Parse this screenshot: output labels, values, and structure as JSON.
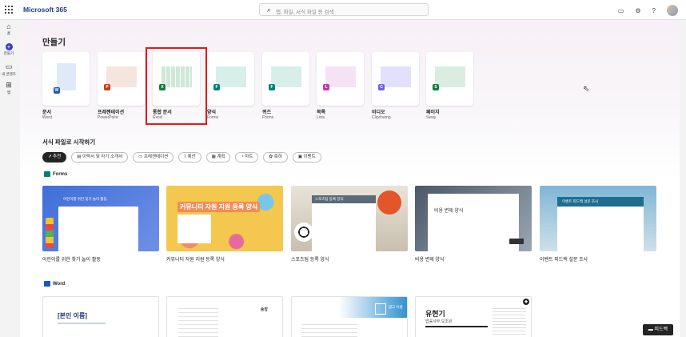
{
  "app": {
    "brand": "Microsoft 365"
  },
  "search": {
    "placeholder": "앱, 파일, 서식 파일 등 검색"
  },
  "rail": [
    {
      "label": "홈",
      "icon": "home-icon"
    },
    {
      "label": "만들기",
      "icon": "create-plus-icon"
    },
    {
      "label": "내 콘텐츠",
      "icon": "folder-icon"
    },
    {
      "label": "앱",
      "icon": "apps-icon"
    }
  ],
  "create": {
    "heading": "만들기",
    "items": [
      {
        "label": "문서",
        "sub": "Word",
        "color": "#185abd"
      },
      {
        "label": "프레젠테이션",
        "sub": "PowerPoint",
        "color": "#c43e1c"
      },
      {
        "label": "통합 문서",
        "sub": "Excel",
        "color": "#107c41"
      },
      {
        "label": "양식",
        "sub": "Forms",
        "color": "#008272"
      },
      {
        "label": "퀴즈",
        "sub": "Forms",
        "color": "#008272"
      },
      {
        "label": "목록",
        "sub": "Lists",
        "color": "#c239b3"
      },
      {
        "label": "비디오",
        "sub": "Clipchamp",
        "color": "#7160e8"
      },
      {
        "label": "페이지",
        "sub": "Sway",
        "color": "#107c41"
      }
    ]
  },
  "templates": {
    "heading": "서식 파일로 시작하기",
    "chips": [
      "추천",
      "이력서 및 자기 소개서",
      "프레젠테이션",
      "예산",
      "계획",
      "차트",
      "축하",
      "이벤트"
    ],
    "forms_label": "Forms",
    "forms": [
      {
        "name": "어린이를 위한 찾기 놀이 활동",
        "inner": "어린이를 위한 찾기 놀이 활동"
      },
      {
        "name": "커뮤니티 자원 지원 등록 양식",
        "inner": "커뮤니티 자원 지원 등록 양식"
      },
      {
        "name": "스포츠팀 등록 양식",
        "inner": "스포츠팀 등록 양식"
      },
      {
        "name": "비용 변제 양식",
        "inner": "비용 변제 양식"
      },
      {
        "name": "이벤트 피드백 설문 조사",
        "inner": "이벤트 피드백 설문 조사"
      }
    ],
    "word_label": "Word",
    "word": [
      {
        "inner": "[본인 이름]"
      },
      {
        "inner": "송장"
      },
      {
        "inner": "광고 이름"
      },
      {
        "inner": "유현기",
        "sub": "법률사무 보조원"
      }
    ]
  },
  "feedback": {
    "label": "피드백"
  }
}
